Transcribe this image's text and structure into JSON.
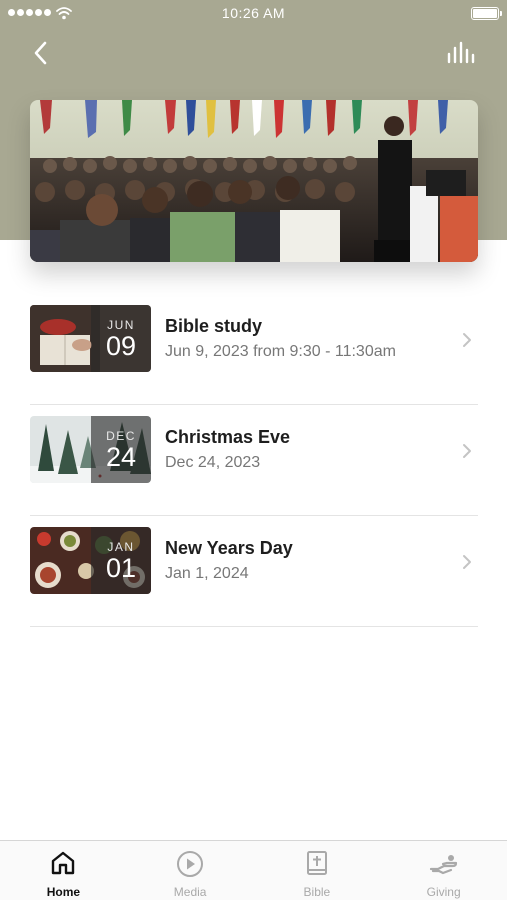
{
  "status_bar": {
    "time": "10:26 AM"
  },
  "header": {
    "back_icon": "chevron-left-icon",
    "audio_icon": "audio-bars-icon",
    "accent_color": "#a8a892"
  },
  "hero": {
    "image": "church-congregation-photo"
  },
  "events": [
    {
      "title": "Bible study",
      "subtitle": "Jun 9, 2023 from 9:30 - 11:30am",
      "month": "JUN",
      "day": "09",
      "thumb": "bible-study-photo"
    },
    {
      "title": "Christmas Eve",
      "subtitle": "Dec 24, 2023",
      "month": "DEC",
      "day": "24",
      "thumb": "snowy-forest-photo"
    },
    {
      "title": "New Years Day",
      "subtitle": "Jan 1, 2024",
      "month": "JAN",
      "day": "01",
      "thumb": "holiday-dinner-photo"
    }
  ],
  "tabs": [
    {
      "label": "Home",
      "icon": "home-icon",
      "active": true
    },
    {
      "label": "Media",
      "icon": "play-circle-icon",
      "active": false
    },
    {
      "label": "Bible",
      "icon": "bible-icon",
      "active": false
    },
    {
      "label": "Giving",
      "icon": "giving-hand-icon",
      "active": false
    }
  ]
}
